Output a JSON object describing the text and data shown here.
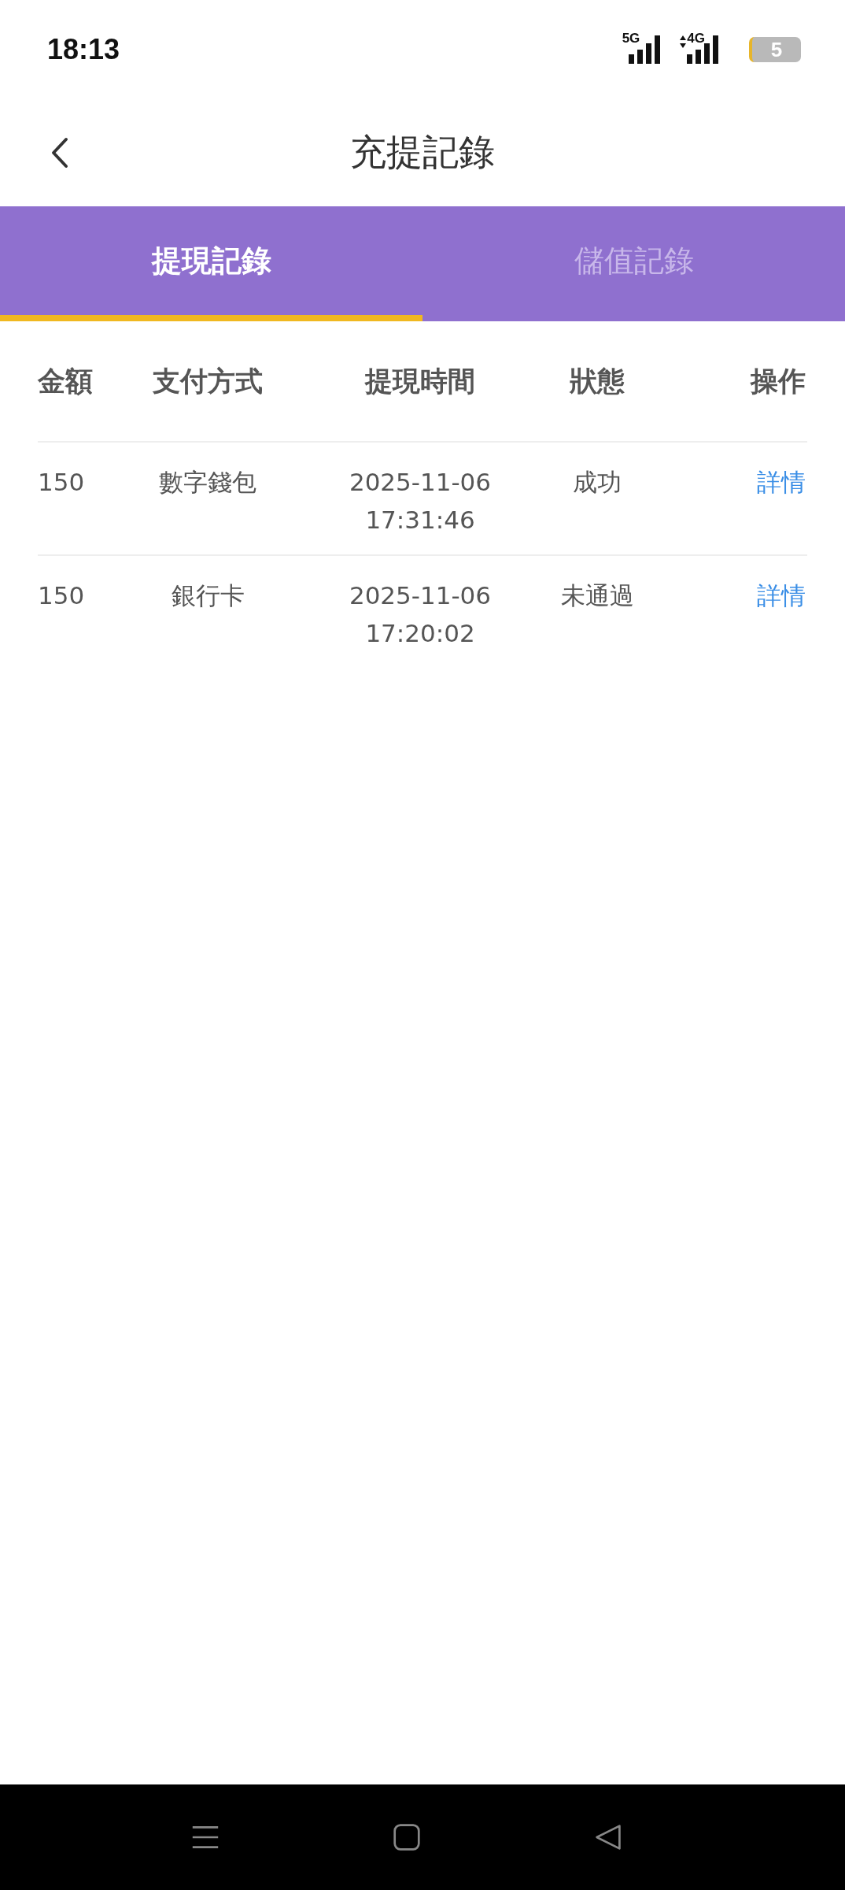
{
  "status_bar": {
    "time": "18:13",
    "network_1": "5G",
    "network_2": "4G",
    "battery": "5"
  },
  "header": {
    "title": "充提記錄"
  },
  "tabs": [
    {
      "label": "提現記錄",
      "selected": true
    },
    {
      "label": "儲值記錄",
      "selected": false
    }
  ],
  "table": {
    "columns": [
      "金額",
      "支付方式",
      "提現時間",
      "狀態",
      "操作"
    ],
    "rows": [
      {
        "amount": "150",
        "method": "數字錢包",
        "date": "2025-11-06",
        "time": "17:31:46",
        "status": "成功",
        "action": "詳情"
      },
      {
        "amount": "150",
        "method": "銀行卡",
        "date": "2025-11-06",
        "time": "17:20:02",
        "status": "未通過",
        "action": "詳情"
      }
    ]
  }
}
